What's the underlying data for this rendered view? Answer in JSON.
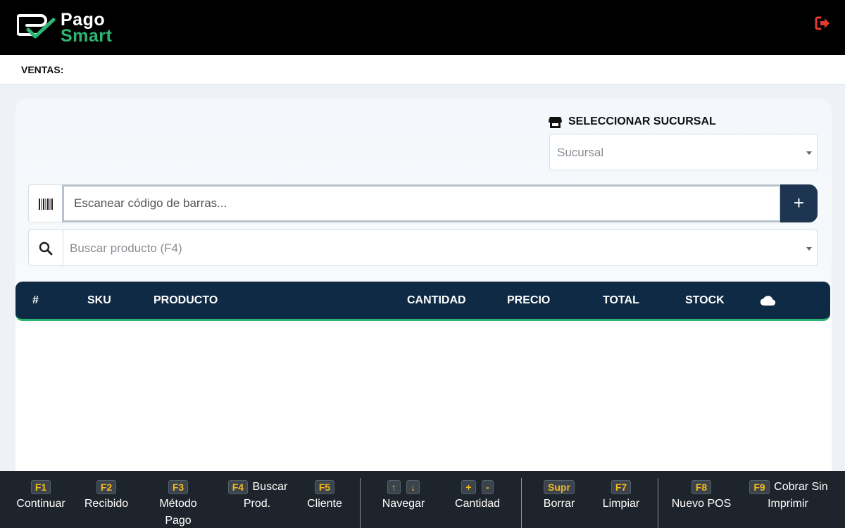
{
  "header": {
    "logo_line1": "Pago",
    "logo_line2": "Smart",
    "brand_color": "#2bb673",
    "logout_icon": "sign-out-icon",
    "logout_color": "#e03b2f"
  },
  "page": {
    "title": "VENTAS:"
  },
  "branch": {
    "label": "SELECCIONAR SUCURSAL",
    "icon": "store-icon",
    "placeholder": "Sucursal"
  },
  "scan": {
    "icon": "barcode-icon",
    "placeholder": "Escanear código de barras...",
    "value": "",
    "add_label": "+"
  },
  "search": {
    "icon": "search-icon",
    "placeholder": "Buscar producto (F4)"
  },
  "table": {
    "columns": [
      "#",
      "SKU",
      "PRODUCTO",
      "CANTIDAD",
      "PRECIO",
      "TOTAL",
      "STOCK"
    ],
    "sync_icon": "cloud-icon",
    "header_color": "#0f2a44",
    "accent_color": "#2bb673",
    "rows": []
  },
  "shortcuts": [
    {
      "keys": [
        "F1"
      ],
      "line1": "",
      "line2": "Continuar"
    },
    {
      "keys": [
        "F2"
      ],
      "line1": "",
      "line2": "Recibido"
    },
    {
      "keys": [
        "F3"
      ],
      "line1": "",
      "line2": "Método",
      "line3": "Pago"
    },
    {
      "keys": [
        "F4"
      ],
      "line1": "Buscar",
      "line2": "Prod."
    },
    {
      "keys": [
        "F5"
      ],
      "line1": "",
      "line2": "Cliente"
    },
    {
      "keys": [
        "↑",
        "↓"
      ],
      "line1": "",
      "line2": "Navegar"
    },
    {
      "keys": [
        "+",
        "-"
      ],
      "line1": "",
      "line2": "Cantidad"
    },
    {
      "keys": [
        "Supr"
      ],
      "line1": "",
      "line2": "Borrar"
    },
    {
      "keys": [
        "F7"
      ],
      "line1": "",
      "line2": "Limpiar"
    },
    {
      "keys": [
        "F8"
      ],
      "line1": "",
      "line2": "Nuevo POS"
    },
    {
      "keys": [
        "F9"
      ],
      "line1": "Cobrar Sin",
      "line2": "Imprimir"
    }
  ],
  "key_color": "#f6b91f"
}
